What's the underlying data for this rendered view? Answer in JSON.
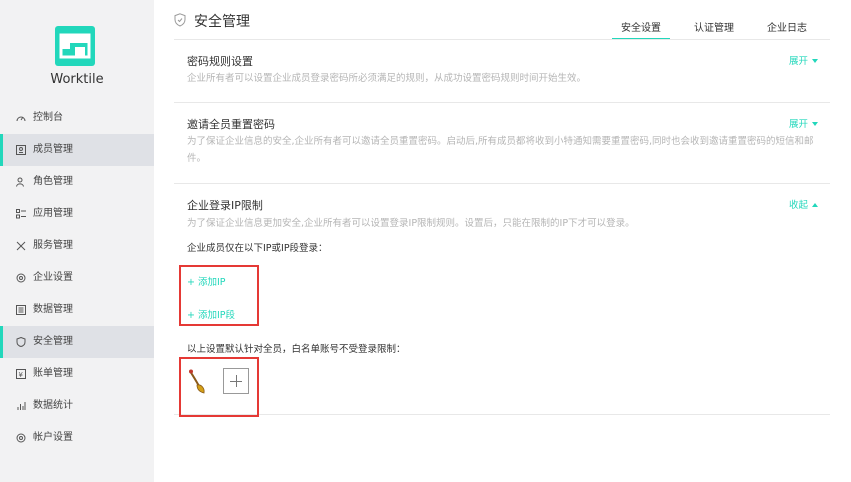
{
  "sidebar": {
    "brand": "Worktile",
    "items": [
      {
        "label": "控制台",
        "icon": "gauge-icon"
      },
      {
        "label": "成员管理",
        "icon": "member-card-icon",
        "active": true
      },
      {
        "label": "角色管理",
        "icon": "role-icon"
      },
      {
        "label": "应用管理",
        "icon": "apps-icon"
      },
      {
        "label": "服务管理",
        "icon": "tools-icon"
      },
      {
        "label": "企业设置",
        "icon": "gear-icon"
      },
      {
        "label": "数据管理",
        "icon": "database-icon"
      },
      {
        "label": "安全管理",
        "icon": "shield-icon",
        "active": true
      },
      {
        "label": "账单管理",
        "icon": "bill-icon"
      },
      {
        "label": "数据统计",
        "icon": "chart-icon"
      },
      {
        "label": "帐户设置",
        "icon": "account-gear-icon"
      }
    ]
  },
  "header": {
    "title": "安全管理",
    "tabs": [
      {
        "label": "安全设置",
        "active": true
      },
      {
        "label": "认证管理"
      },
      {
        "label": "企业日志"
      }
    ]
  },
  "sections": {
    "password": {
      "title": "密码规则设置",
      "desc": "企业所有者可以设置企业成员登录密码所必须满足的规则，从成功设置密码规则时间开始生效。",
      "toggle": "展开"
    },
    "reset": {
      "title": "邀请全员重置密码",
      "desc": "为了保证企业信息的安全,企业所有者可以邀请全员重置密码。启动后,所有成员都将收到小特通知需要重置密码,同时也会收到邀请重置密码的短信和邮件。",
      "toggle": "展开"
    },
    "ip": {
      "title": "企业登录IP限制",
      "desc": "为了保证企业信息更加安全,企业所有者可以设置登录IP限制规则。设置后，只能在限制的IP下才可以登录。",
      "toggle": "收起",
      "allow_label": "企业成员仅在以下IP或IP段登录：",
      "add_ip": "+ 添加IP",
      "add_ip_range": "+ 添加IP段",
      "whitelist_label": "以上设置默认针对全员，白名单账号不受登录限制："
    }
  },
  "colors": {
    "accent": "#22d7bb",
    "highlight": "#e53935"
  }
}
